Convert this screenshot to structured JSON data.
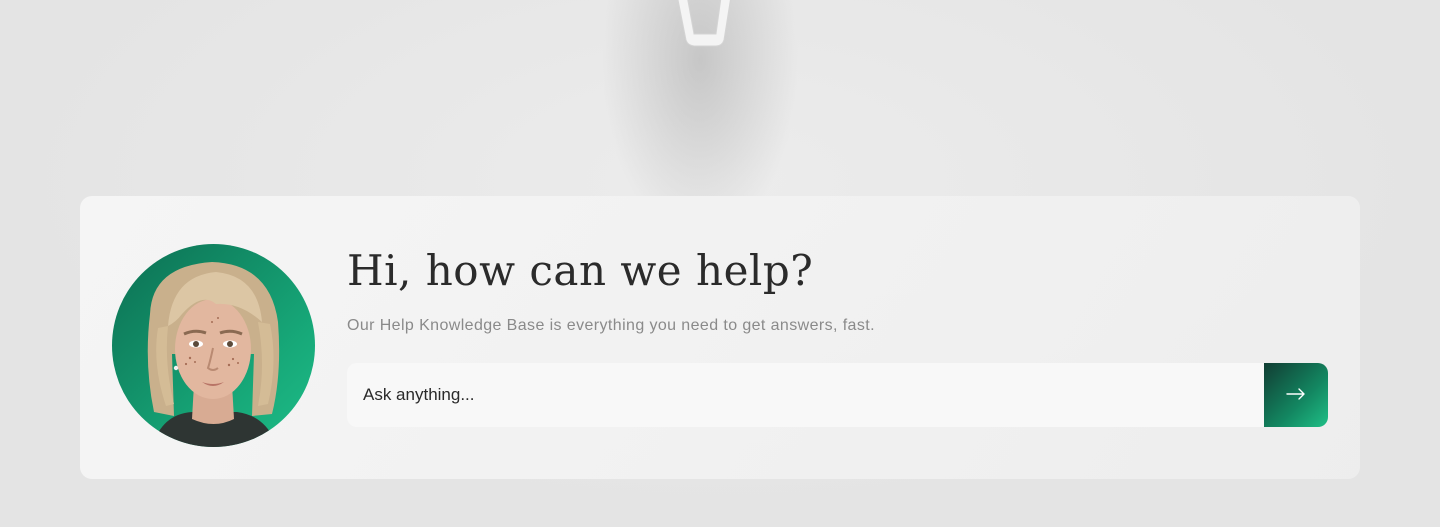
{
  "hero": {
    "heading": "Hi, how can we help?",
    "subtitle": "Our Help Knowledge Base is everything you need to get answers, fast."
  },
  "search": {
    "placeholder": "Ask anything...",
    "submit_icon": "arrow-right-icon"
  },
  "colors": {
    "accent_dark": "#113d33",
    "accent_light": "#1fbf86",
    "avatar_bg": "#17a979"
  }
}
